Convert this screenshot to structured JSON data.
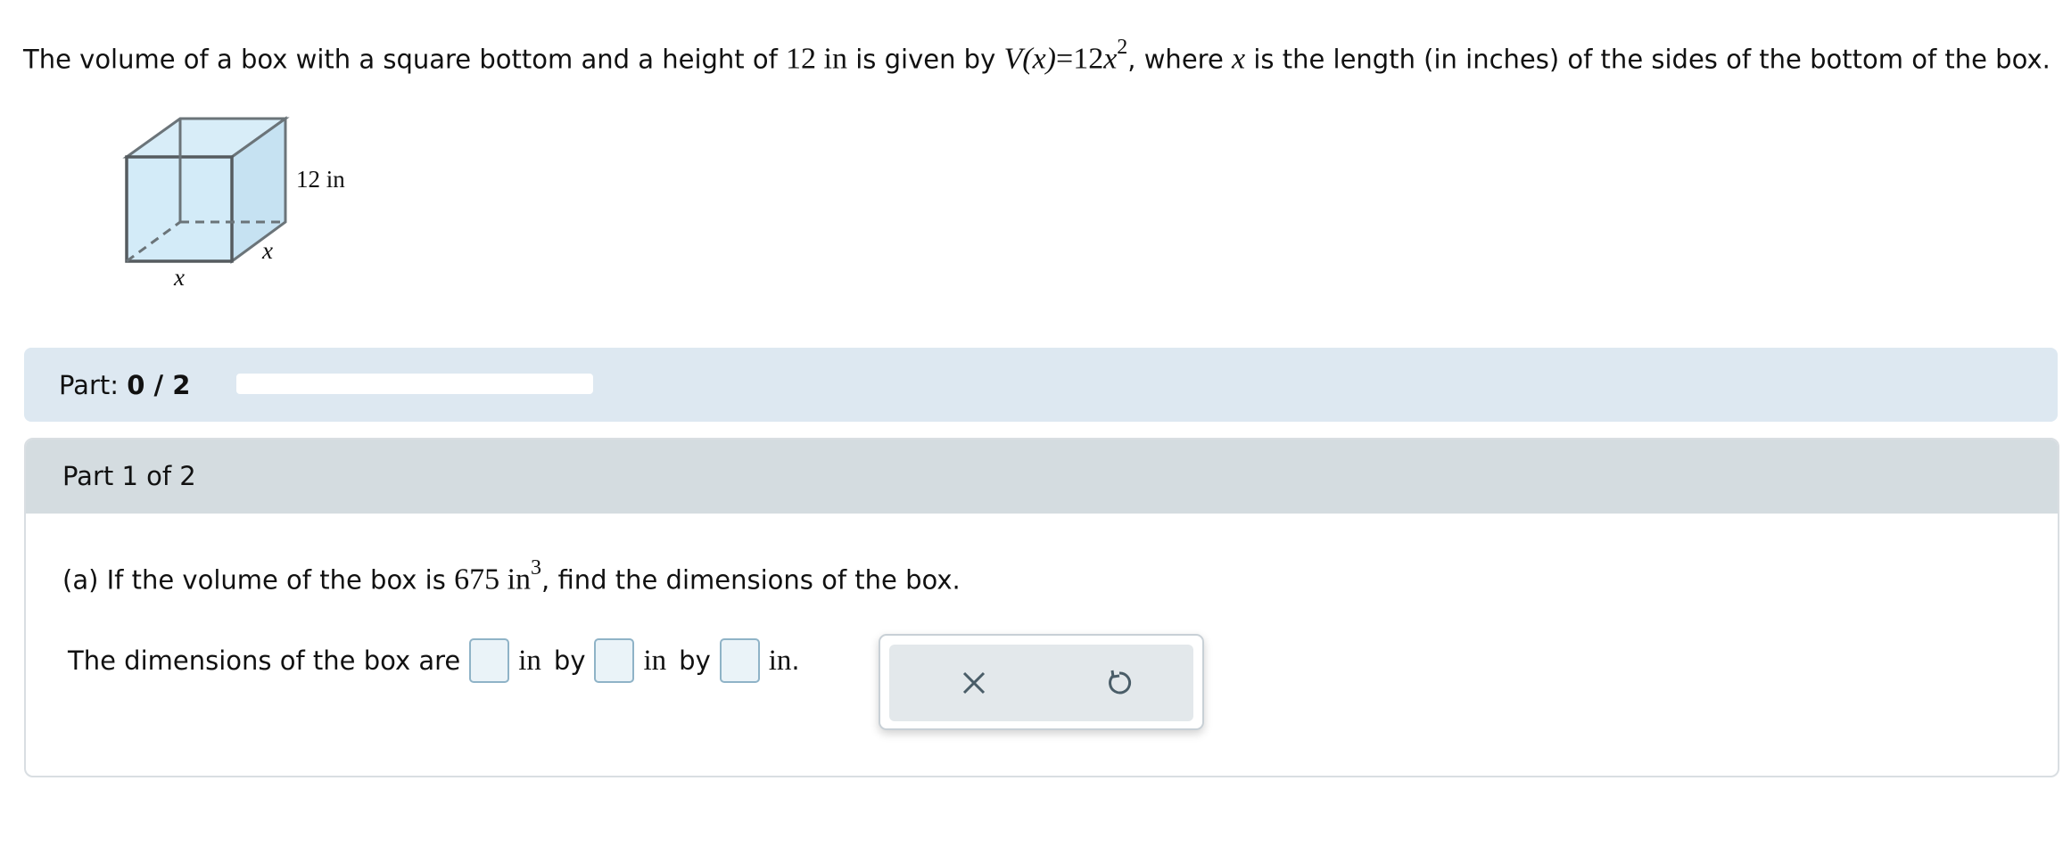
{
  "problem": {
    "text1": "The volume of a box with a square bottom and a height of ",
    "height_value": "12 in",
    "text2": " is given by ",
    "func_name": "V",
    "func_arg": "(x)",
    "equals": "=",
    "func_coef": "12",
    "func_var": "x",
    "func_exp": "2",
    "text3": ", where ",
    "var": "x",
    "text4": " is the length (in inches) of the sides of the bottom of the box."
  },
  "figure": {
    "height_label": "12 in",
    "side_label_front": "x",
    "side_label_depth": "x"
  },
  "progress": {
    "label_prefix": "Part: ",
    "label_value": "0 / 2",
    "fraction": 0
  },
  "part": {
    "header": "Part 1 of 2",
    "question_prefix": "(a) If the volume of the box is ",
    "question_value": "675 in",
    "question_exp": "3",
    "question_suffix": ", find the dimensions of the box.",
    "answer_prefix": "The dimensions of the box are",
    "unit_in": "in",
    "by": "by",
    "end_unit": "in",
    "period": "."
  },
  "tools": {
    "clear_icon": "close-icon",
    "reset_icon": "undo-icon"
  },
  "colors": {
    "box_fill": "#cfe8f6",
    "part_bar": "#dde8f1",
    "part_header": "#d4dce0"
  }
}
